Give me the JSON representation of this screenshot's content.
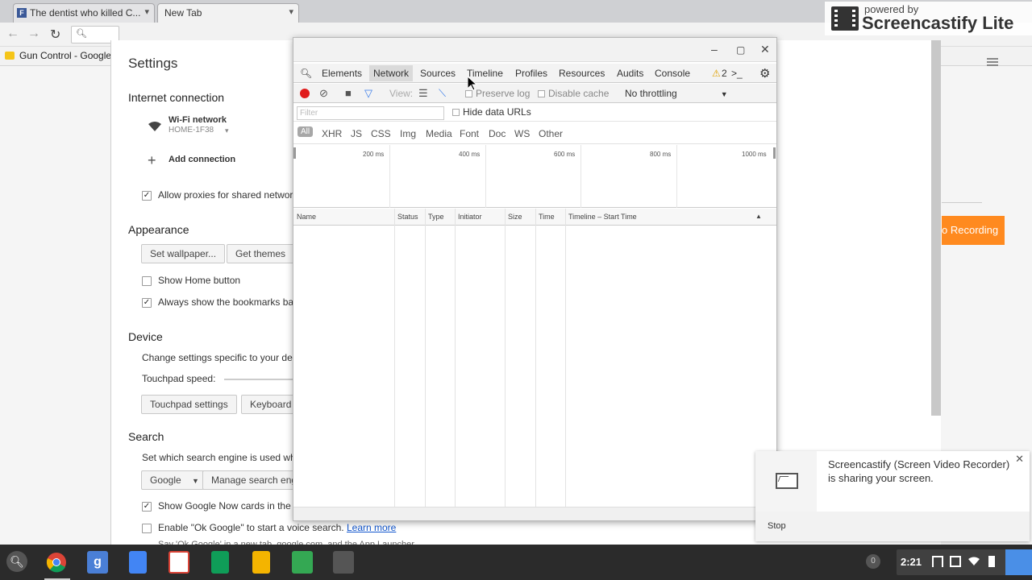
{
  "browser": {
    "tabs": [
      {
        "title": "The dentist who killed C..."
      },
      {
        "title": "New Tab"
      }
    ],
    "bookmark": "Gun Control - Google"
  },
  "settings": {
    "title": "Settings",
    "internet": {
      "heading": "Internet connection",
      "network_type": "Wi-Fi network",
      "network_name": "HOME-1F38",
      "add_connection": "Add connection",
      "proxies": "Allow proxies for shared networ"
    },
    "appearance": {
      "heading": "Appearance",
      "set_wallpaper": "Set wallpaper...",
      "get_themes": "Get themes",
      "show_home": "Show Home button",
      "show_bookmarks": "Always show the bookmarks ba"
    },
    "device": {
      "heading": "Device",
      "desc": "Change settings specific to your de",
      "touchpad_speed": "Touchpad speed:",
      "touchpad_settings": "Touchpad settings",
      "keyboard": "Keyboard"
    },
    "search": {
      "heading": "Search",
      "desc": "Set which search engine is used wh",
      "engine": "Google",
      "manage": "Manage search eng",
      "google_now": "Show Google Now cards in the l",
      "ok_google": "Enable \"Ok Google\" to start a voice search.",
      "learn_more": "Learn more",
      "footer": "Say 'Ok Google' in a new tab, google.com, and the App Launcher"
    }
  },
  "right_panel": {
    "recording_label": "o Recording"
  },
  "devtools": {
    "tabs": [
      "Elements",
      "Network",
      "Sources",
      "Timeline",
      "Profiles",
      "Resources",
      "Audits",
      "Console"
    ],
    "active_tab": "Network",
    "warning_count": "2",
    "toolbar": {
      "view_label": "View:",
      "preserve_log": "Preserve log",
      "disable_cache": "Disable cache",
      "throttling": "No throttling"
    },
    "filter_placeholder": "Filter",
    "hide_data_urls": "Hide data URLs",
    "filter_types": [
      "All",
      "XHR",
      "JS",
      "CSS",
      "Img",
      "Media",
      "Font",
      "Doc",
      "WS",
      "Other"
    ],
    "overview_ticks": [
      "200 ms",
      "400 ms",
      "600 ms",
      "800 ms",
      "1000 ms"
    ],
    "columns": [
      "Name",
      "Status",
      "Type",
      "Initiator",
      "Size",
      "Time",
      "Timeline – Start Time"
    ]
  },
  "watermark": {
    "powered_by": "powered by",
    "product": "Screencastify Lite"
  },
  "notification": {
    "message": "Screencastify (Screen Video Recorder) is sharing your screen.",
    "stop": "Stop"
  },
  "shelf": {
    "notification_count": "0",
    "time": "2:21"
  },
  "colors": {
    "record_red": "#e01b1b",
    "recording_orange": "#ff8a1f",
    "shelf_bg": "#2b2b2b",
    "tray_accent": "#4a8fe7"
  }
}
